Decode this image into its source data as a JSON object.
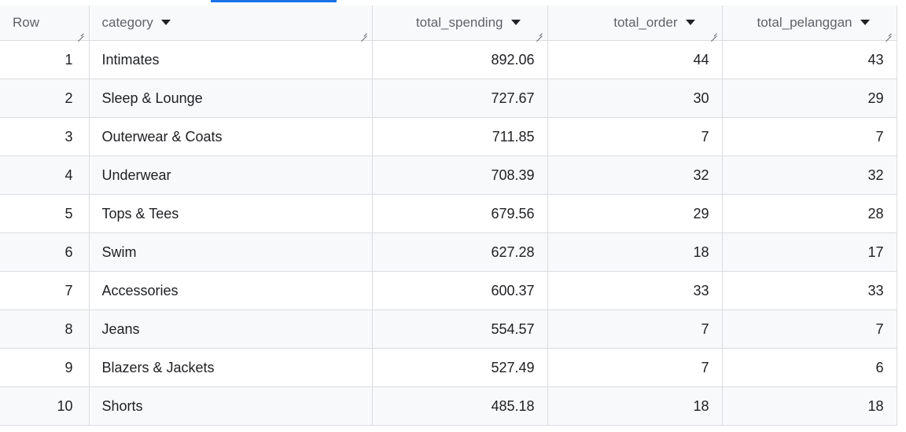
{
  "columns": [
    {
      "label": "Row",
      "sortable": false
    },
    {
      "label": "category",
      "sortable": true
    },
    {
      "label": "total_spending",
      "sortable": true
    },
    {
      "label": "total_order",
      "sortable": true
    },
    {
      "label": "total_pelanggan",
      "sortable": true
    }
  ],
  "rows": [
    {
      "row": "1",
      "category": "Intimates",
      "total_spending": "892.06",
      "total_order": "44",
      "total_pelanggan": "43"
    },
    {
      "row": "2",
      "category": "Sleep & Lounge",
      "total_spending": "727.67",
      "total_order": "30",
      "total_pelanggan": "29"
    },
    {
      "row": "3",
      "category": "Outerwear & Coats",
      "total_spending": "711.85",
      "total_order": "7",
      "total_pelanggan": "7"
    },
    {
      "row": "4",
      "category": "Underwear",
      "total_spending": "708.39",
      "total_order": "32",
      "total_pelanggan": "32"
    },
    {
      "row": "5",
      "category": "Tops & Tees",
      "total_spending": "679.56",
      "total_order": "29",
      "total_pelanggan": "28"
    },
    {
      "row": "6",
      "category": "Swim",
      "total_spending": "627.28",
      "total_order": "18",
      "total_pelanggan": "17"
    },
    {
      "row": "7",
      "category": "Accessories",
      "total_spending": "600.37",
      "total_order": "33",
      "total_pelanggan": "33"
    },
    {
      "row": "8",
      "category": "Jeans",
      "total_spending": "554.57",
      "total_order": "7",
      "total_pelanggan": "7"
    },
    {
      "row": "9",
      "category": "Blazers & Jackets",
      "total_spending": "527.49",
      "total_order": "7",
      "total_pelanggan": "6"
    },
    {
      "row": "10",
      "category": "Shorts",
      "total_spending": "485.18",
      "total_order": "18",
      "total_pelanggan": "18"
    }
  ],
  "colors": {
    "active_tab_indicator": "#1a73e8",
    "header_bg": "#f8f9fa",
    "stripe_bg": "#f8f9fa",
    "border": "#dadce0"
  }
}
